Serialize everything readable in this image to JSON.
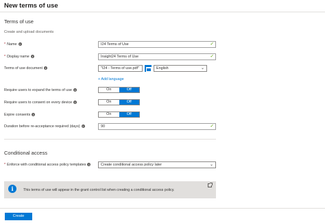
{
  "page": {
    "title": "New terms of use"
  },
  "terms_section": {
    "title": "Terms of use",
    "subtitle": "Create and upload documents",
    "name": {
      "label": "Name",
      "value": "I24 Terms of Use"
    },
    "display_name": {
      "label": "Display name",
      "value": "Insight24 Terms of Use"
    },
    "document": {
      "label": "Terms of use document",
      "file": "\"I24 - Terms of use.pdf\"",
      "language": "English",
      "add_language": "+ Add language"
    },
    "expand": {
      "label": "Require users to expand the terms of use",
      "on": "On",
      "off": "Off",
      "state": "Off"
    },
    "every_device": {
      "label": "Require users to consent on every device",
      "on": "On",
      "off": "Off",
      "state": "Off"
    },
    "expire": {
      "label": "Expire consents",
      "on": "On",
      "off": "Off",
      "state": "Off"
    },
    "duration": {
      "label": "Duration before re-acceptance required (days)",
      "value": "90"
    }
  },
  "conditional_section": {
    "title": "Conditional access",
    "enforce": {
      "label": "Enforce with conditional access policy templates",
      "value": "Create conditional access policy later"
    }
  },
  "banner": {
    "text": "This terms of use will appear in the grant control list when creating a conditional access policy."
  },
  "footer": {
    "create_label": "Create"
  },
  "icons": {
    "check": "checkmark-icon",
    "info": "info-icon",
    "folder": "folder-icon",
    "external": "external-link-icon"
  },
  "colors": {
    "accent": "#0078d4",
    "valid": "#57a300",
    "required": "#a4262c",
    "banner_bg": "#e1dfdd"
  }
}
